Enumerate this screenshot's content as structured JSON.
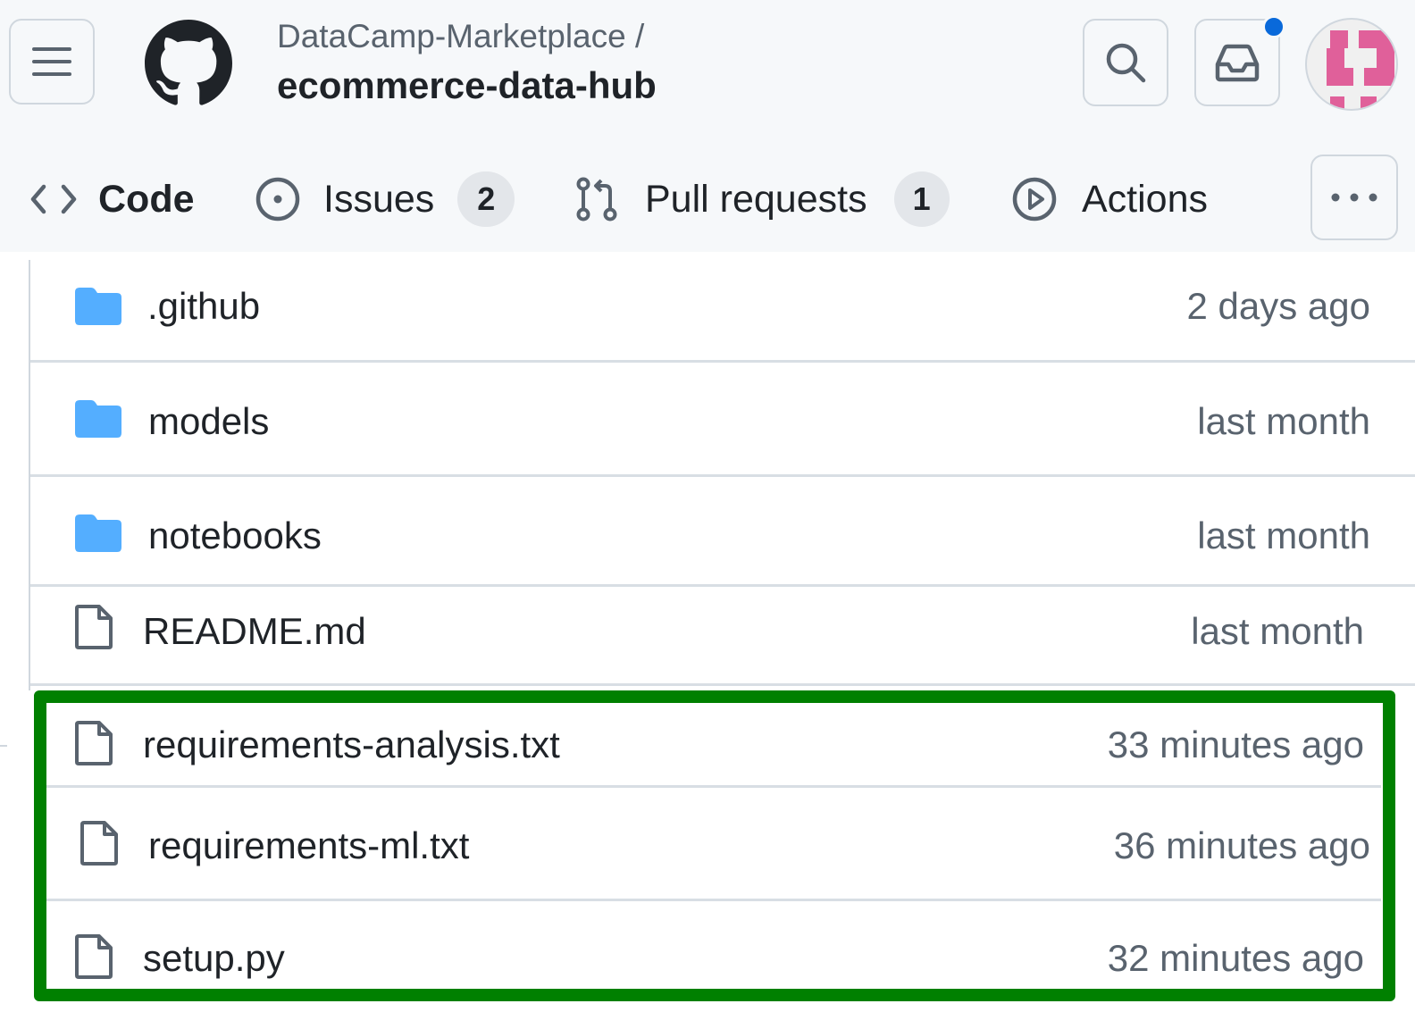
{
  "header": {
    "owner": "DataCamp-Marketplace",
    "separator": "/",
    "repo": "ecommerce-data-hub",
    "menu_icon": "hamburger-icon",
    "logo_icon": "github-logo-icon",
    "search_icon": "search-icon",
    "inbox_icon": "inbox-icon",
    "has_unread_notifications": true,
    "notification_dot_color": "#0969da",
    "avatar_color": "#e0609a"
  },
  "tabs": [
    {
      "label": "Code",
      "icon": "code-icon",
      "selected": true
    },
    {
      "label": "Issues",
      "icon": "issue-opened-icon",
      "count": "2"
    },
    {
      "label": "Pull requests",
      "icon": "git-pull-request-icon",
      "count": "1"
    },
    {
      "label": "Actions",
      "icon": "play-icon"
    }
  ],
  "more_icon": "kebab-horizontal-icon",
  "files": [
    {
      "name": ".github",
      "type": "folder",
      "updated": "2 days ago"
    },
    {
      "name": "models",
      "type": "folder",
      "updated": "last month"
    },
    {
      "name": "notebooks",
      "type": "folder",
      "updated": "last month"
    },
    {
      "name": "README.md",
      "type": "file",
      "updated": "last month"
    },
    {
      "name": "requirements-analysis.txt",
      "type": "file",
      "updated": "33 minutes ago"
    },
    {
      "name": "requirements-ml.txt",
      "type": "file",
      "updated": "36 minutes ago"
    },
    {
      "name": "setup.py",
      "type": "file",
      "updated": "32 minutes ago"
    }
  ],
  "highlight_color": "#008000",
  "folder_color": "#54aeff"
}
